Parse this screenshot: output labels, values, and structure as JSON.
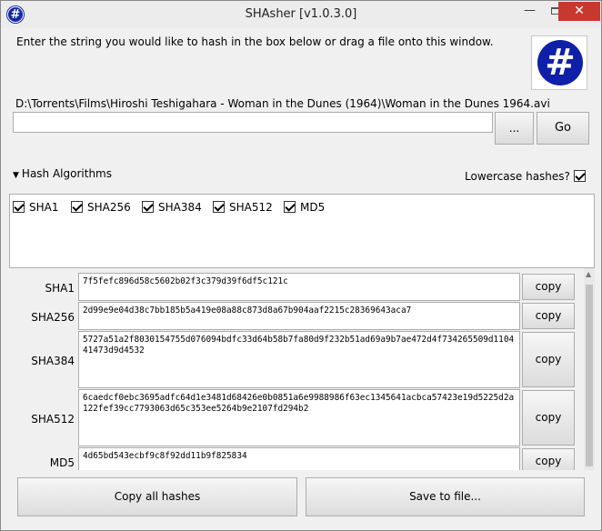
{
  "window": {
    "title": "SHAsher [v1.0.3.0]",
    "app_icon_glyph": "#",
    "minimize_glyph": "—",
    "close_glyph": "✕"
  },
  "header": {
    "instruction": "Enter the string you would like to hash in the box below or drag a file onto this window.",
    "logo_glyph": "#"
  },
  "input": {
    "file_path": "D:\\Torrents\\Films\\Hiroshi Teshigahara - Woman in the Dunes (1964)\\Woman in the Dunes 1964.avi",
    "value": "",
    "browse_label": "...",
    "go_label": "Go"
  },
  "algorithms": {
    "toggle_label": "Hash Algorithms",
    "lowercase_label": "Lowercase hashes?",
    "lowercase_checked": true,
    "items": [
      {
        "label": "SHA1",
        "checked": true
      },
      {
        "label": "SHA256",
        "checked": true
      },
      {
        "label": "SHA384",
        "checked": true
      },
      {
        "label": "SHA512",
        "checked": true
      },
      {
        "label": "MD5",
        "checked": true
      }
    ]
  },
  "results": [
    {
      "label": "SHA1",
      "hash": "7f5fefc896d58c5602b02f3c379d39f6df5c121c",
      "copy_label": "copy"
    },
    {
      "label": "SHA256",
      "hash": "2d99e9e04d38c7bb185b5a419e08a88c873d8a67b904aaf2215c28369643aca7",
      "copy_label": "copy"
    },
    {
      "label": "SHA384",
      "hash": "5727a51a2f8030154755d076094bdfc33d64b58b7fa80d9f232b51ad69a9b7ae472d4f734265509d110441473d9d4532",
      "copy_label": "copy"
    },
    {
      "label": "SHA512",
      "hash": "6caedcf0ebc3695adfc64d1e3481d68426e0b0851a6e9988986f63ec1345641acbca57423e19d5225d2a122fef39cc7793063d65c353ee5264b9e2107fd294b2",
      "copy_label": "copy"
    },
    {
      "label": "MD5",
      "hash": "4d65bd543ecbf9c8f92dd11b9f825834",
      "copy_label": "copy"
    }
  ],
  "footer": {
    "copy_all_label": "Copy all hashes",
    "save_label": "Save to file..."
  }
}
